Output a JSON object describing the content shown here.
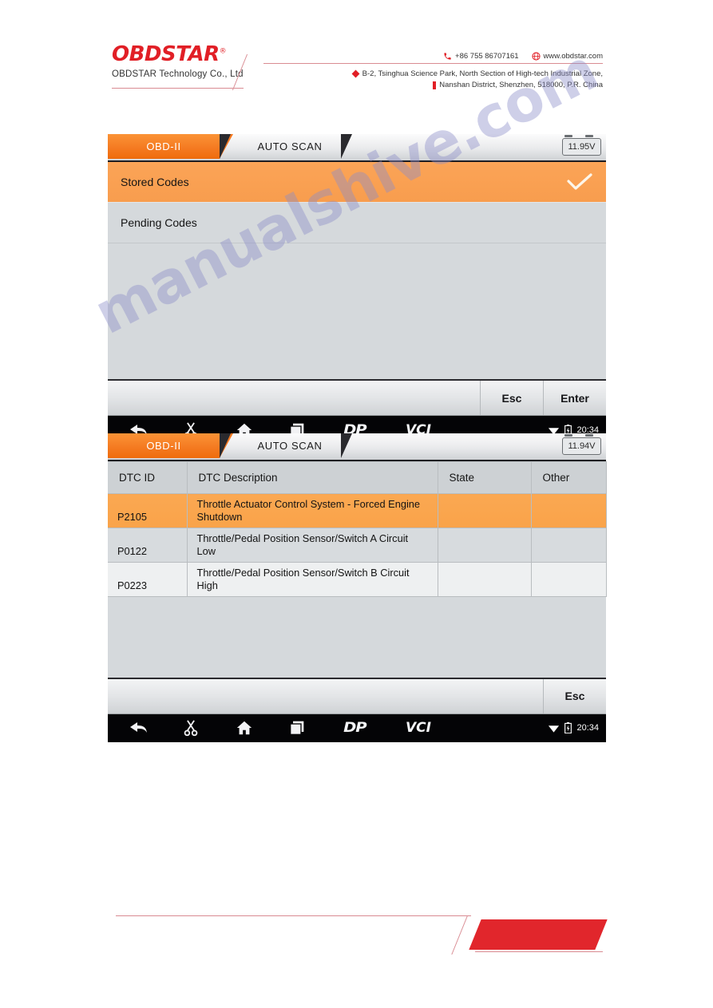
{
  "header": {
    "logo_text": "OBDSTAR",
    "logo_reg": "®",
    "company": "OBDSTAR Technology Co., Ltd",
    "phone_icon": "phone-icon",
    "phone": "+86 755 86707161",
    "globe_icon": "globe-icon",
    "website": "www.obdstar.com",
    "address_line1": "B-2, Tsinghua Science Park, North Section of High-tech Industrial Zone,",
    "address_line2": "Nanshan District, Shenzhen, 518000, P.R.   China"
  },
  "watermark": {
    "text": "manualshive.com"
  },
  "screenshot1": {
    "tabs": [
      {
        "label": "OBD-II",
        "active": true
      },
      {
        "label": "AUTO SCAN",
        "active": false
      }
    ],
    "voltage": "11.95V",
    "list": [
      {
        "label": "Stored Codes",
        "selected": true,
        "check_icon": "check-icon"
      },
      {
        "label": "Pending Codes",
        "selected": false
      }
    ],
    "actions": [
      {
        "label": "Esc"
      },
      {
        "label": "Enter"
      }
    ],
    "navbar": {
      "back_icon": "back-arrow-icon",
      "screenshot_icon": "scissors-icon",
      "home_icon": "home-icon",
      "recents_icon": "recents-icon",
      "dp_logo": "DP",
      "vci_logo": "VCI",
      "wifi_icon": "wifi-icon",
      "battery_icon": "battery-icon",
      "clock": "20:34"
    }
  },
  "screenshot2": {
    "tabs": [
      {
        "label": "OBD-II",
        "active": true
      },
      {
        "label": "AUTO SCAN",
        "active": false
      }
    ],
    "voltage": "11.94V",
    "table": {
      "columns": [
        "DTC ID",
        "DTC Description",
        "State",
        "Other"
      ],
      "rows": [
        {
          "dtc_id": "P2105",
          "description": "Throttle Actuator Control System - Forced Engine Shutdown",
          "state": "",
          "other": "",
          "highlighted": true
        },
        {
          "dtc_id": "P0122",
          "description": "Throttle/Pedal Position Sensor/Switch A Circuit Low",
          "state": "",
          "other": "",
          "highlighted": false
        },
        {
          "dtc_id": "P0223",
          "description": "Throttle/Pedal Position Sensor/Switch B Circuit High",
          "state": "",
          "other": "",
          "highlighted": false
        }
      ]
    },
    "actions": [
      {
        "label": "Esc"
      }
    ],
    "navbar": {
      "back_icon": "back-arrow-icon",
      "screenshot_icon": "scissors-icon",
      "home_icon": "home-icon",
      "recents_icon": "recents-icon",
      "dp_logo": "DP",
      "vci_logo": "VCI",
      "wifi_icon": "wifi-icon",
      "battery_icon": "battery-icon",
      "clock": "20:34"
    }
  },
  "colors": {
    "brand_red": "#e11f26",
    "accent_orange": "#f47920",
    "row_highlight": "#fba852",
    "panel_bg": "#d5d9dc",
    "navbar_bg": "#040406"
  }
}
